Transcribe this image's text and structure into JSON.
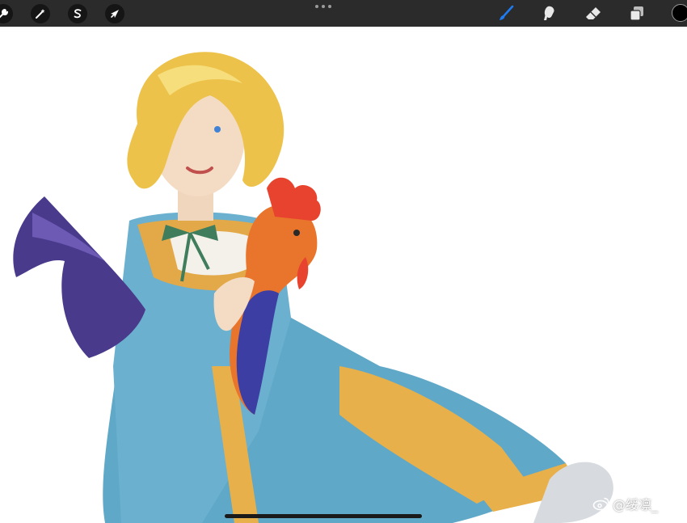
{
  "toolbar": {
    "left_tools": [
      {
        "name": "actions",
        "icon": "wrench-icon"
      },
      {
        "name": "adjustments",
        "icon": "magic-wand-icon"
      },
      {
        "name": "selection",
        "icon": "selection-s-icon"
      },
      {
        "name": "transform",
        "icon": "arrow-cursor-icon"
      }
    ],
    "center": {
      "icon": "more-dots-icon"
    },
    "right_tools": [
      {
        "name": "brush",
        "icon": "brush-icon",
        "active": true
      },
      {
        "name": "smudge",
        "icon": "smudge-icon"
      },
      {
        "name": "eraser",
        "icon": "eraser-icon"
      },
      {
        "name": "layers",
        "icon": "layers-icon"
      }
    ],
    "current_color": "#000000",
    "active_color": "#1e7bf0",
    "background": "#2b2b2b"
  },
  "canvas": {
    "artwork_subject": "illustration",
    "watermark": "@绥凛_",
    "watermark_icon": "weibo-icon"
  }
}
